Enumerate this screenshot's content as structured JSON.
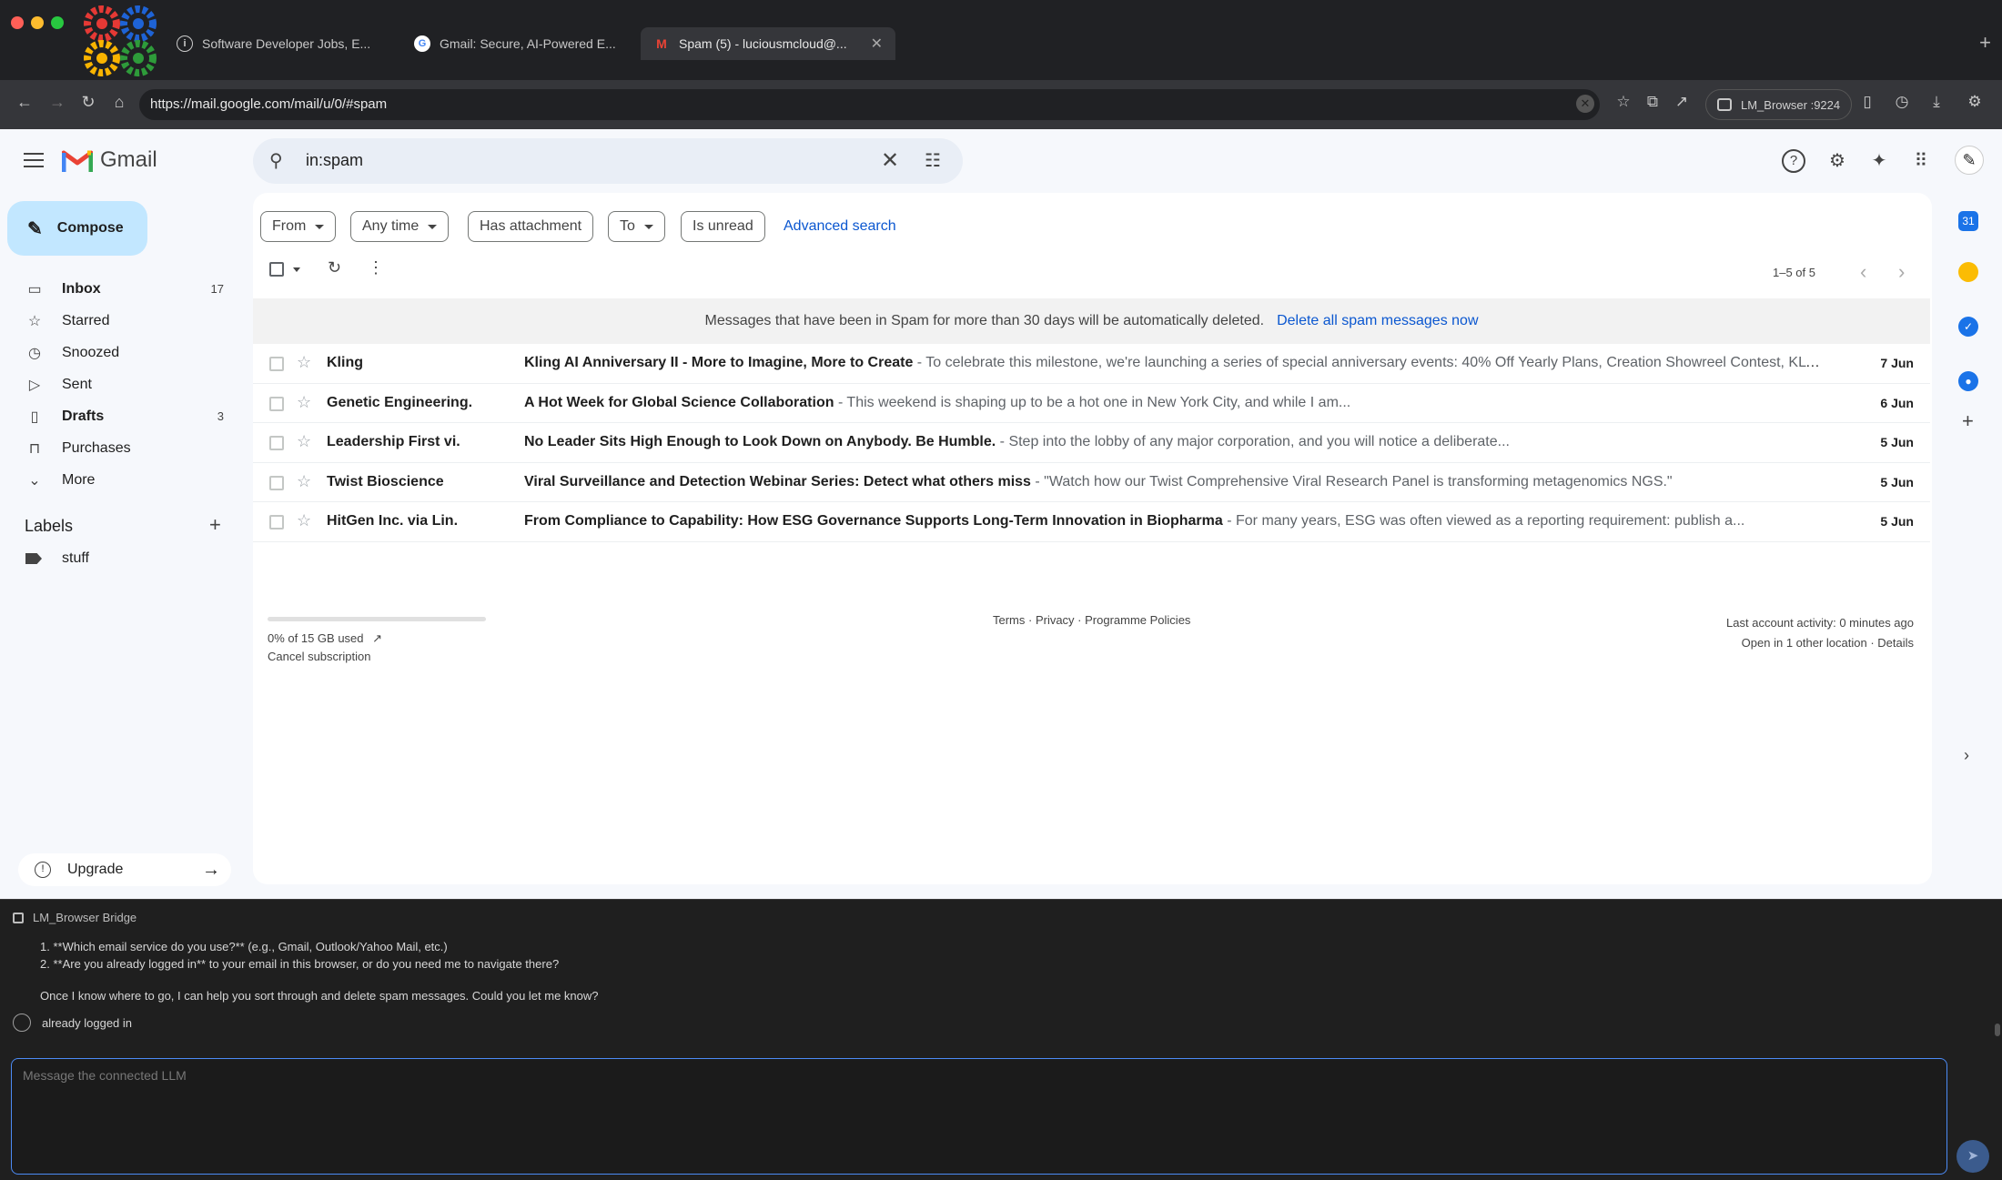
{
  "colors": {
    "chrome_bg": "#202124",
    "toolbar_bg": "#35363a",
    "gmail_bg": "#f6f8fc",
    "compose_bg": "#c2e7ff",
    "link_blue": "#0b57d0",
    "gmail_red": "#ea4335"
  },
  "browser": {
    "tabs": [
      {
        "icon": "info-icon",
        "title": "Software Developer Jobs, E..."
      },
      {
        "icon": "google-icon",
        "title": "Gmail: Secure, AI-Powered E..."
      },
      {
        "icon": "gmail-icon",
        "title": "Spam (5) - luciousmcloud@...",
        "active": true
      }
    ],
    "new_tab": "+",
    "url": "https://mail.google.com/mail/u/0/#spam",
    "profile_label": "LM_Browser :9224"
  },
  "gmail": {
    "brand": "Gmail",
    "search_value": "in:spam",
    "compose_label": "Compose",
    "nav": [
      {
        "id": "inbox",
        "icon": "inbox-icon",
        "label": "Inbox",
        "count": "17",
        "bold": true
      },
      {
        "id": "starred",
        "icon": "star-icon",
        "label": "Starred",
        "count": ""
      },
      {
        "id": "snoozed",
        "icon": "clock-icon",
        "label": "Snoozed",
        "count": ""
      },
      {
        "id": "sent",
        "icon": "send-icon",
        "label": "Sent",
        "count": ""
      },
      {
        "id": "drafts",
        "icon": "draft-icon",
        "label": "Drafts",
        "count": "3",
        "bold": true
      },
      {
        "id": "purchases",
        "icon": "bag-icon",
        "label": "Purchases",
        "count": ""
      },
      {
        "id": "more",
        "icon": "chevron-down-icon",
        "label": "More",
        "count": ""
      }
    ],
    "labels_heading": "Labels",
    "labels": [
      {
        "name": "stuff"
      }
    ],
    "upgrade_label": "Upgrade",
    "filters": {
      "from": "From",
      "any_time": "Any time",
      "has_attachment": "Has attachment",
      "to": "To",
      "is_unread": "Is unread",
      "advanced": "Advanced search"
    },
    "pager": "1–5 of 5",
    "notice": {
      "text": "Messages that have been in Spam for more than 30 days will be automatically deleted.",
      "action": "Delete all spam messages now"
    },
    "emails": [
      {
        "sender": "Kling",
        "subject": "Kling AI Anniversary II - More to Imagine, More to Create",
        "snippet": " - To celebrate this milestone, we're launching a series of special anniversary events: 40% Off Yearly Plans, Creation Showreel Contest, KLTI Creat...",
        "date": "7 Jun"
      },
      {
        "sender": "Genetic Engineering.",
        "subject": "A Hot Week for Global Science Collaboration",
        "snippet": " - This weekend is shaping up to be a hot one in New York City, and while I am...",
        "date": "6 Jun"
      },
      {
        "sender": "Leadership First vi.",
        "subject": "No Leader Sits High Enough to Look Down on Anybody. Be Humble.",
        "snippet": " - Step into the lobby of any major corporation, and you will notice a deliberate...",
        "date": "5 Jun"
      },
      {
        "sender": "Twist Bioscience",
        "subject": "Viral Surveillance and Detection Webinar Series: Detect what others miss",
        "snippet": " - \"Watch how our Twist Comprehensive Viral Research Panel is transforming metagenomics NGS.\"",
        "date": "5 Jun"
      },
      {
        "sender": "HitGen Inc. via Lin.",
        "subject": "From Compliance to Capability: How ESG Governance Supports Long-Term Innovation in Biopharma",
        "snippet": " - For many years, ESG was often viewed as a reporting requirement: publish a...",
        "date": "5 Jun"
      }
    ],
    "footer": {
      "storage_used_fraction": 0,
      "storage": "0% of 15 GB used",
      "cancel": "Cancel subscription",
      "policies": "Terms · Privacy · Programme Policies",
      "activity": "Last account activity: 0 minutes ago",
      "other_location": "Open in 1 other location · Details"
    }
  },
  "bridge": {
    "title": "LM_Browser Bridge",
    "lines": [
      "1. **Which email service do you use?** (e.g., Gmail, Outlook/Yahoo Mail, etc.)",
      "2. **Are you already logged in** to your email in this browser, or do you need me to navigate there?",
      "Once I know where to go, I can help you sort through and delete spam messages. Could you let me know?"
    ],
    "user_message": "already logged in",
    "input_placeholder": "Message the connected LLM"
  }
}
